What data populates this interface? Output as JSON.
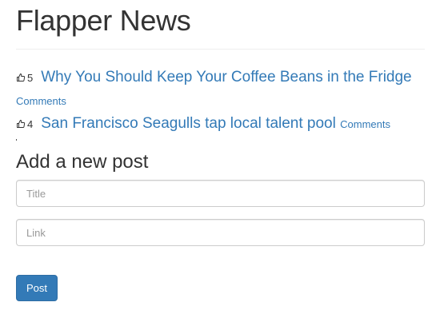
{
  "header": {
    "title": "Flapper News"
  },
  "posts": [
    {
      "upvote_icon": "thumbs-up-icon",
      "votes": "5",
      "title": "Why You Should Keep Your Coffee Beans in the Fridge",
      "comments_label": "Comments"
    },
    {
      "upvote_icon": "thumbs-up-icon",
      "votes": "4",
      "title": "San Francisco Seagulls tap local talent pool",
      "comments_label": "Comments"
    }
  ],
  "form": {
    "heading": "Add a new post",
    "title_placeholder": "Title",
    "title_value": "",
    "link_placeholder": "Link",
    "link_value": "",
    "submit_label": "Post"
  },
  "colors": {
    "link": "#337ab7",
    "button_bg": "#337ab7",
    "text": "#333333"
  }
}
